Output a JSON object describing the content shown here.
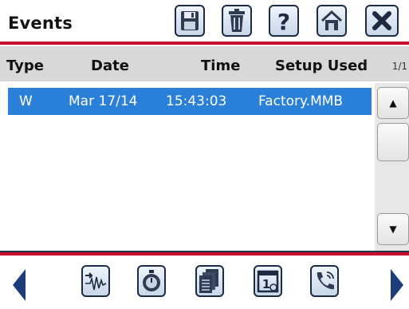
{
  "header": {
    "title": "Events",
    "buttons": [
      {
        "name": "save-icon"
      },
      {
        "name": "trash-icon"
      },
      {
        "name": "help-icon"
      },
      {
        "name": "home-icon"
      },
      {
        "name": "close-icon"
      }
    ]
  },
  "table": {
    "columns": [
      "Type",
      "Date",
      "Time",
      "Setup Used"
    ],
    "page_info": "1/1",
    "rows": [
      {
        "type": "W",
        "date": "Mar 17/14",
        "time": "15:43:03",
        "setup": "Factory.MMB",
        "selected": true
      }
    ]
  },
  "scrollbar": {
    "up_icon": "triangle-up-icon",
    "down_icon": "triangle-down-icon"
  },
  "footer": {
    "buttons": [
      {
        "name": "waveform-export-icon"
      },
      {
        "name": "timer-icon"
      },
      {
        "name": "documents-icon"
      },
      {
        "name": "calendar-icon"
      },
      {
        "name": "phone-icon"
      }
    ],
    "prev_icon": "arrow-left-icon",
    "next_icon": "arrow-right-icon"
  },
  "colors": {
    "accent_red": "#c8102e",
    "selection_blue": "#2a80d8",
    "header_gray": "#d8d8d8",
    "button_border": "#1c2a44"
  }
}
